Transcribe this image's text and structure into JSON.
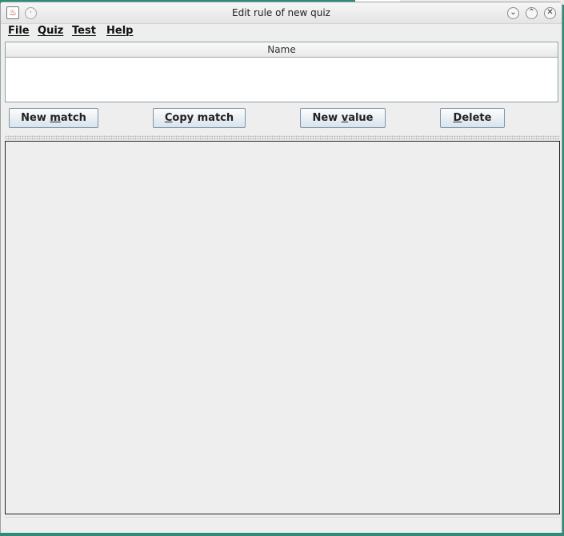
{
  "window": {
    "title": "Edit rule of new quiz",
    "menu_glyph": "·",
    "controls": {
      "minimize": "⌄",
      "maximize": "⌃",
      "close": "✕"
    }
  },
  "menubar": {
    "items": [
      {
        "mnemonic": "F",
        "rest": "ile"
      },
      {
        "mnemonic": "Q",
        "rest": "uiz"
      },
      {
        "mnemonic": "T",
        "rest": "est"
      },
      {
        "mnemonic": "H",
        "rest": "elp"
      }
    ]
  },
  "table": {
    "columns": [
      "Name"
    ],
    "rows": []
  },
  "buttons": {
    "new_match": {
      "before": "New ",
      "mnemonic": "m",
      "after": "atch"
    },
    "copy_match": {
      "before": "",
      "mnemonic": "C",
      "after": "opy match"
    },
    "new_value": {
      "before": "New ",
      "mnemonic": "v",
      "after": "alue"
    },
    "delete": {
      "before": "",
      "mnemonic": "D",
      "after": "elete"
    }
  },
  "colors": {
    "desktop": "#2f8a78",
    "window_bg": "#eeeeee",
    "button_border": "#7f94a6"
  }
}
